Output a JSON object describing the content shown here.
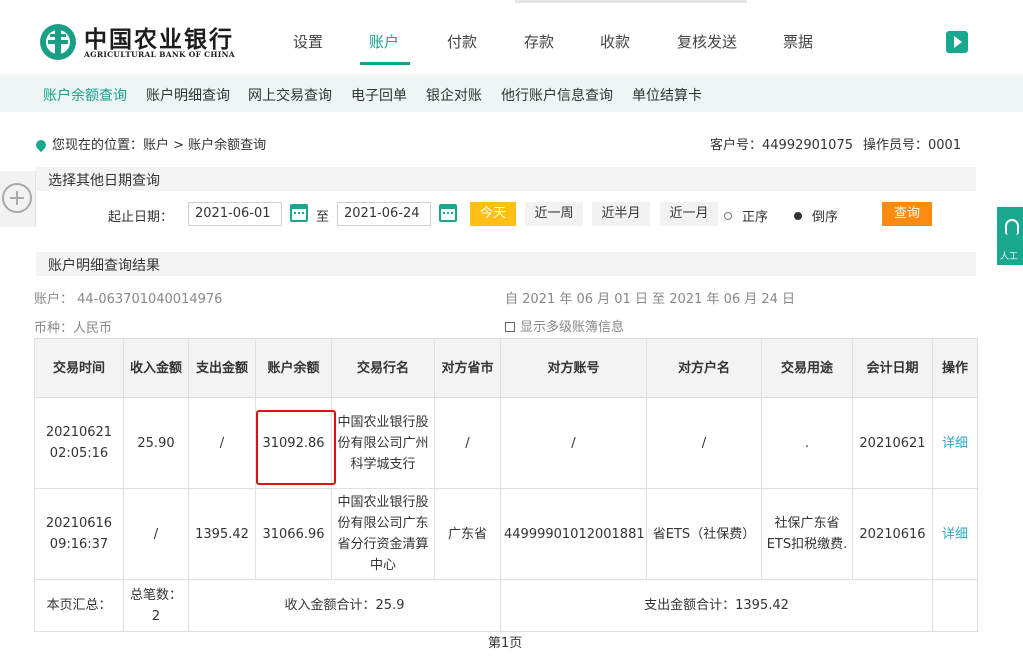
{
  "header": {
    "logo_cn": "中国农业银行",
    "logo_en": "AGRICULTURAL BANK OF CHINA",
    "nav": [
      "设置",
      "账户",
      "付款",
      "存款",
      "收款",
      "复核发送",
      "票据"
    ],
    "active_nav": "账户",
    "accent_color": "#16a18c"
  },
  "subnav": {
    "items": [
      "账户余额查询",
      "账户明细查询",
      "网上交易查询",
      "电子回单",
      "银企对账",
      "他行账户信息查询",
      "单位结算卡"
    ],
    "active": "账户余额查询"
  },
  "location": {
    "text": "您现在的位置：账户 > 账户余额查询",
    "customer": "客户号：44992901075",
    "operator": "操作员号：0001"
  },
  "query": {
    "section_title": "选择其他日期查询",
    "date_label": "起止日期：",
    "start_date": "2021-06-01",
    "to_label": "至",
    "end_date": "2021-06-24",
    "btn_today": "今天",
    "btn_week": "近一周",
    "btn_halfmonth": "近半月",
    "btn_month": "近一月",
    "order_asc": "正序",
    "order_desc": "倒序",
    "selected_order": "倒序",
    "btn_query": "查询"
  },
  "right_widget": {
    "label": "人工"
  },
  "result": {
    "section_title": "账户明细查询结果",
    "account": "账户： 44-063701040014976",
    "period": "自 2021 年 06 月 01 日 至 2021 年 06 月 24 日",
    "currency": "币种：人民币",
    "multilevel": "显示多级账簿信息",
    "columns": [
      "交易时间",
      "收入金额",
      "支出金额",
      "账户余额",
      "交易行名",
      "对方省市",
      "对方账号",
      "对方户名",
      "交易用途",
      "会计日期",
      "操作"
    ],
    "rows": [
      {
        "time": "20210621 02:05:16",
        "income": "25.90",
        "expense": "/",
        "balance": "31092.86",
        "bank": "中国农业银行股份有限公司广州科学城支行",
        "province": "/",
        "account": "/",
        "name": "/",
        "purpose": ".",
        "date": "20210621",
        "action": "详细"
      },
      {
        "time": "20210616 09:16:37",
        "income": "/",
        "expense": "1395.42",
        "balance": "31066.96",
        "bank": "中国农业银行股份有限公司广东省分行资金清算中心",
        "province": "广东省",
        "account": "44999901012001881",
        "name": "省ETS（社保费）",
        "purpose": "社保广东省ETS扣税缴费.",
        "date": "20210616",
        "action": "详细"
      }
    ],
    "summary": {
      "label": "本页汇总：",
      "count": "总笔数：2",
      "income_total": "收入金额合计：25.9",
      "expense_total": "支出金额合计：1395.42"
    },
    "page": "第1页"
  }
}
